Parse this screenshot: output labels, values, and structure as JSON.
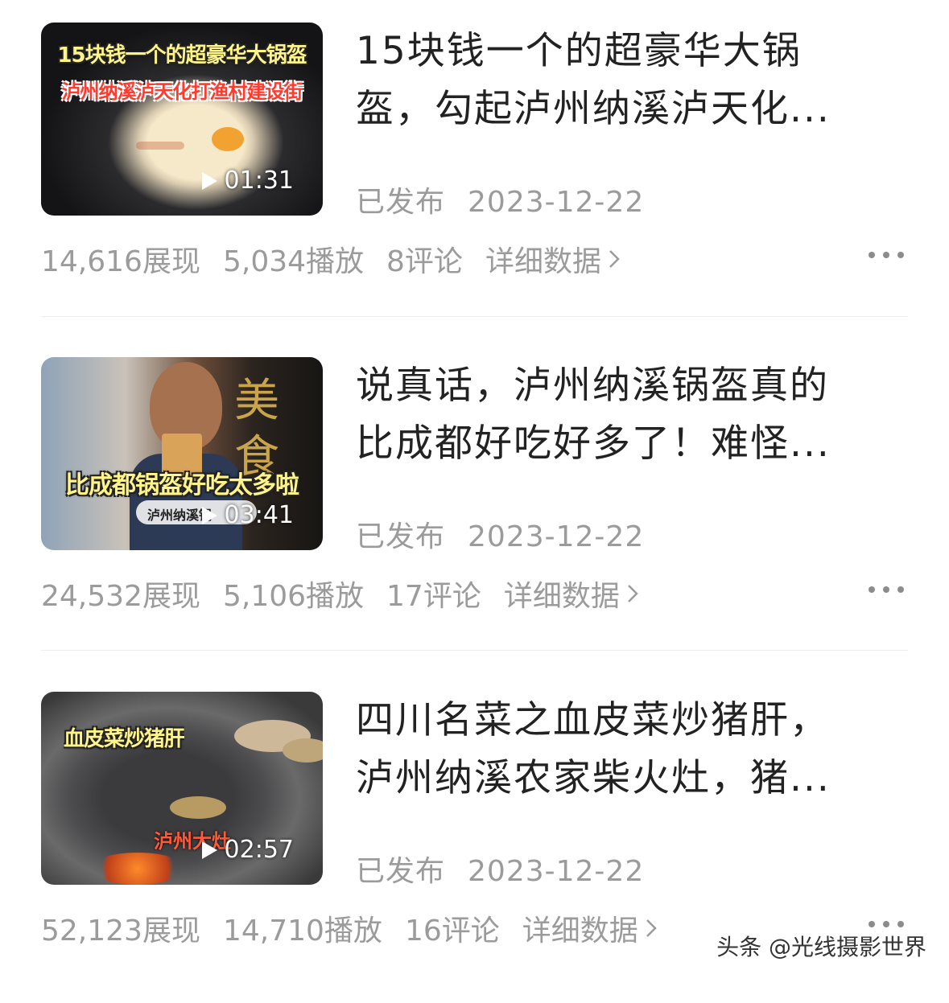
{
  "items": [
    {
      "thumb_caption_1": "15块钱一个的超豪华大锅盔",
      "thumb_caption_2": "泸州纳溪泸天化打渔村建设街",
      "duration": "01:31",
      "title_line1": "15块钱一个的超豪华大锅",
      "title_line2": "盔，勾起泸州纳溪泸天化...",
      "status": "已发布",
      "date": "2023-12-22",
      "impressions": "14,616展现",
      "plays": "5,034播放",
      "comments": "8评论",
      "detail": "详细数据"
    },
    {
      "thumb_caption_1": "比成都锅盔好吃太多啦",
      "thumb_caption_2": "泸州纳溪锅",
      "duration": "03:41",
      "title_line1": "说真话，泸州纳溪锅盔真的",
      "title_line2": "比成都好吃好多了！难怪...",
      "status": "已发布",
      "date": "2023-12-22",
      "impressions": "24,532展现",
      "plays": "5,106播放",
      "comments": "17评论",
      "detail": "详细数据"
    },
    {
      "thumb_caption_1": "血皮菜炒猪肝",
      "thumb_caption_2": "泸州大灶",
      "duration": "02:57",
      "title_line1": "四川名菜之血皮菜炒猪肝，",
      "title_line2": "泸州纳溪农家柴火灶，猪...",
      "status": "已发布",
      "date": "2023-12-22",
      "impressions": "52,123展现",
      "plays": "14,710播放",
      "comments": "16评论",
      "detail": "详细数据"
    }
  ],
  "watermark": "头条 @光线摄影世界"
}
